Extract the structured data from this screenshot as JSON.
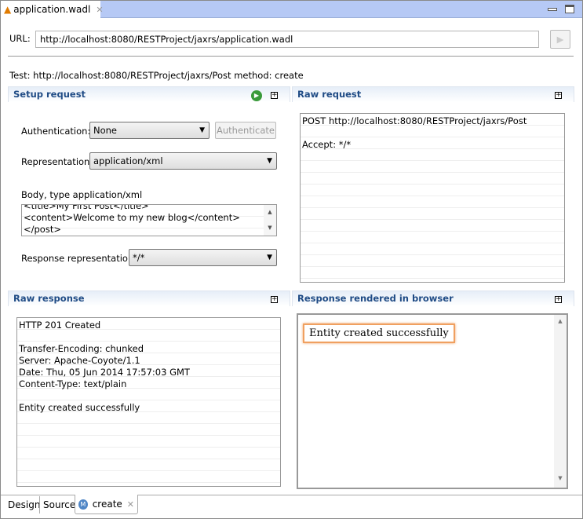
{
  "editor_tab": {
    "title": "application.wadl",
    "icon": "wadl-icon"
  },
  "url": {
    "label": "URL:",
    "value": "http://localhost:8080/RESTProject/jaxrs/application.wadl"
  },
  "test_line": "Test: http://localhost:8080/RESTProject/jaxrs/Post method: create",
  "setup": {
    "title": "Setup request",
    "auth_label": "Authentication:",
    "auth_value": "None",
    "authenticate": "Authenticate",
    "repr_label": "Representation:",
    "repr_value": "application/xml",
    "body_label": "Body, type application/xml",
    "body_lines": [
      "<title>My First Post</title>",
      "<content>Welcome to my new blog</content>",
      "</post>"
    ],
    "resp_repr_label": "Response representation:",
    "resp_repr_value": "*/*"
  },
  "raw_request": {
    "title": "Raw request",
    "lines": [
      "POST http://localhost:8080/RESTProject/jaxrs/Post",
      "",
      "Accept: */*"
    ]
  },
  "raw_response": {
    "title": "Raw response",
    "lines": [
      "HTTP 201 Created",
      "",
      "Transfer-Encoding: chunked",
      "Server: Apache-Coyote/1.1",
      "Date: Thu, 05 Jun 2014 17:57:03 GMT",
      "Content-Type: text/plain",
      "",
      "Entity created successfully"
    ]
  },
  "rendered": {
    "title": "Response rendered in browser",
    "text": "Entity created successfully"
  },
  "bottom_tabs": [
    {
      "label": "Design"
    },
    {
      "label": "Source"
    },
    {
      "label": "create"
    }
  ]
}
